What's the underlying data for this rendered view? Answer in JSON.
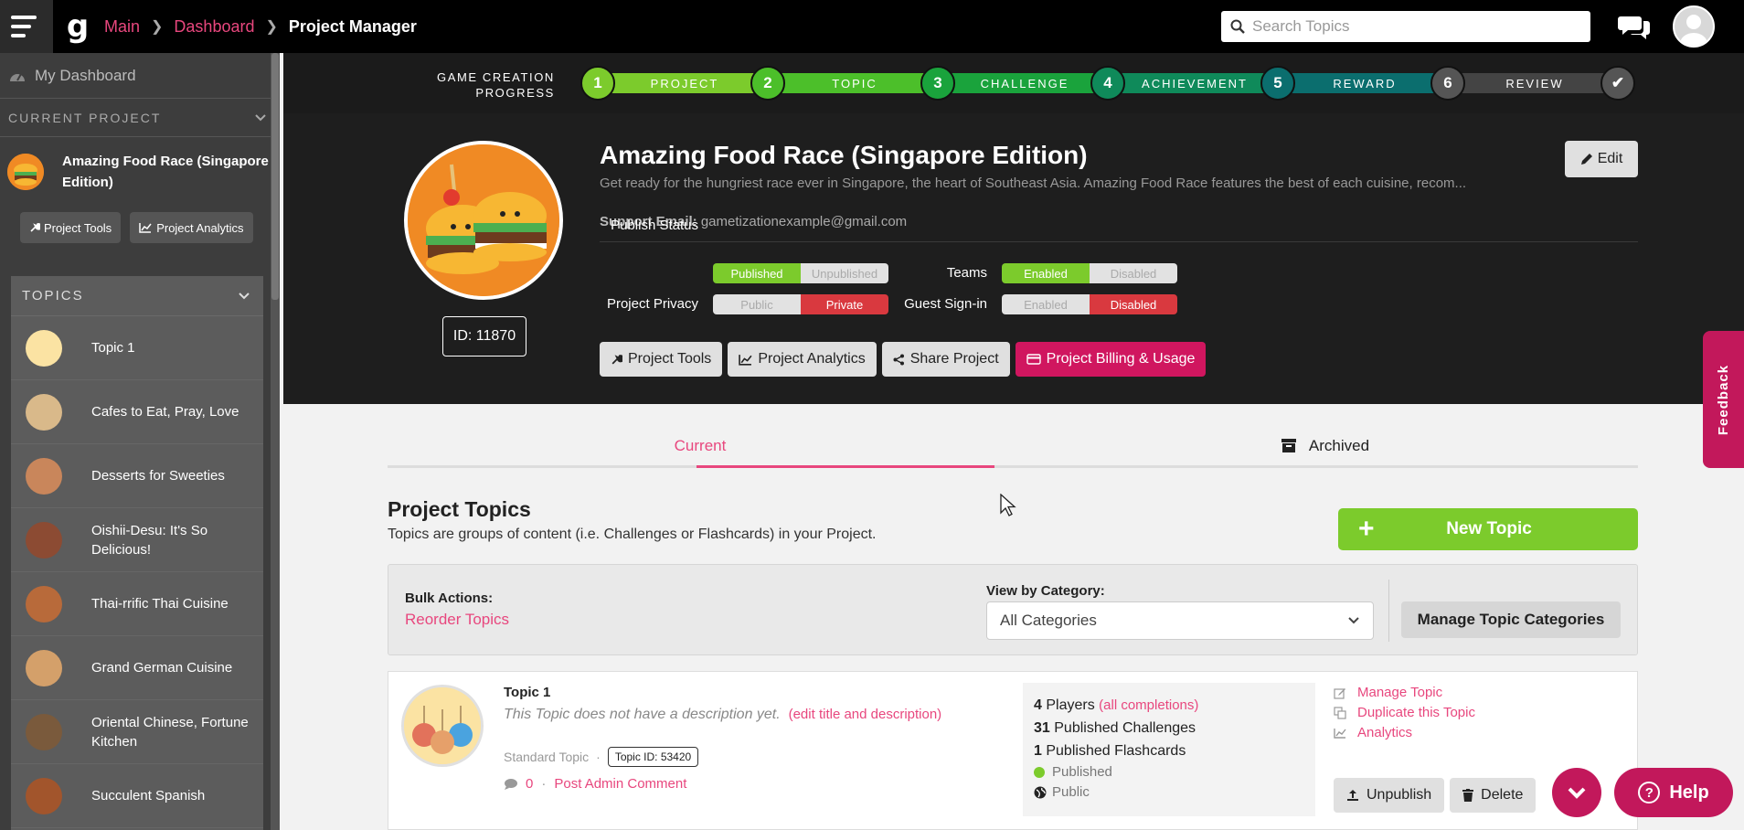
{
  "header": {
    "breadcrumbs": [
      "Main",
      "Dashboard",
      "Project Manager"
    ],
    "search_placeholder": "Search Topics"
  },
  "sidebar": {
    "my_dashboard": "My Dashboard",
    "current_project_label": "CURRENT PROJECT",
    "project_name": "Amazing Food Race (Singapore Edition)",
    "project_tools": "Project Tools",
    "project_analytics": "Project Analytics",
    "topics_label": "TOPICS",
    "topics": [
      "Topic 1",
      "Cafes to Eat, Pray, Love",
      "Desserts for Sweeties",
      "Oishii-Desu: It's So Delicious!",
      "Thai-rrific Thai Cuisine",
      "Grand German Cuisine",
      "Oriental Chinese, Fortune Kitchen",
      "Succulent Spanish"
    ]
  },
  "progress": {
    "label_line1": "GAME CREATION",
    "label_line2": "PROGRESS",
    "steps": [
      {
        "num": "1",
        "label": "PROJECT",
        "color": "#7ccb2c"
      },
      {
        "num": "2",
        "label": "TOPIC",
        "color": "#4cbf2a"
      },
      {
        "num": "3",
        "label": "CHALLENGE",
        "color": "#1aa33c"
      },
      {
        "num": "4",
        "label": "ACHIEVEMENT",
        "color": "#0f8a5a"
      },
      {
        "num": "5",
        "label": "REWARD",
        "color": "#0b6e6e"
      },
      {
        "num": "6",
        "label": "REVIEW",
        "color": "#555555"
      }
    ],
    "final_check": "✔"
  },
  "project": {
    "title": "Amazing Food Race (Singapore Edition)",
    "description": "Get ready for the hungriest race ever in Singapore, the heart of Southeast Asia. Amazing Food Race features the best of each cuisine, recom...",
    "support_email_label": "Support Email:",
    "support_email": "gametizationexample@gmail.com",
    "id_label": "ID: 11870",
    "edit": "Edit",
    "publish_status_label": "Publish Status",
    "publish_on": "Published",
    "publish_off": "Unpublished",
    "privacy_label": "Project Privacy",
    "privacy_public": "Public",
    "privacy_private": "Private",
    "teams_label": "Teams",
    "teams_on": "Enabled",
    "teams_off": "Disabled",
    "guest_label": "Guest Sign-in",
    "guest_on": "Enabled",
    "guest_off": "Disabled",
    "btn_tools": "Project Tools",
    "btn_analytics": "Project Analytics",
    "btn_share": "Share Project",
    "btn_billing": "Project Billing & Usage"
  },
  "feedback": "Feedback",
  "tabs": {
    "current": "Current",
    "archived": "Archived"
  },
  "topics_section": {
    "title": "Project Topics",
    "subtitle": "Topics are groups of content (i.e. Challenges or Flashcards) in your Project.",
    "new_topic": "New Topic",
    "bulk_actions": "Bulk Actions:",
    "reorder": "Reorder Topics",
    "view_by_category": "View by Category:",
    "category_value": "All Categories",
    "manage_categories": "Manage Topic Categories"
  },
  "topic_card": {
    "title": "Topic 1",
    "desc": "This Topic does not have a description yet.",
    "edit_link": "(edit title and description)",
    "type": "Standard Topic",
    "topic_id": "Topic ID: 53420",
    "comments": "0",
    "post_comment": "Post Admin Comment",
    "players_count": "4",
    "players_label": "Players",
    "all_completions": "(all completions)",
    "challenges_count": "31",
    "challenges_label": "Published Challenges",
    "flashcards_count": "1",
    "flashcards_label": "Published Flashcards",
    "status": "Published",
    "visibility": "Public",
    "manage": "Manage Topic",
    "duplicate": "Duplicate this Topic",
    "analytics": "Analytics",
    "unpublish": "Unpublish",
    "delete": "Delete"
  },
  "help": "Help"
}
